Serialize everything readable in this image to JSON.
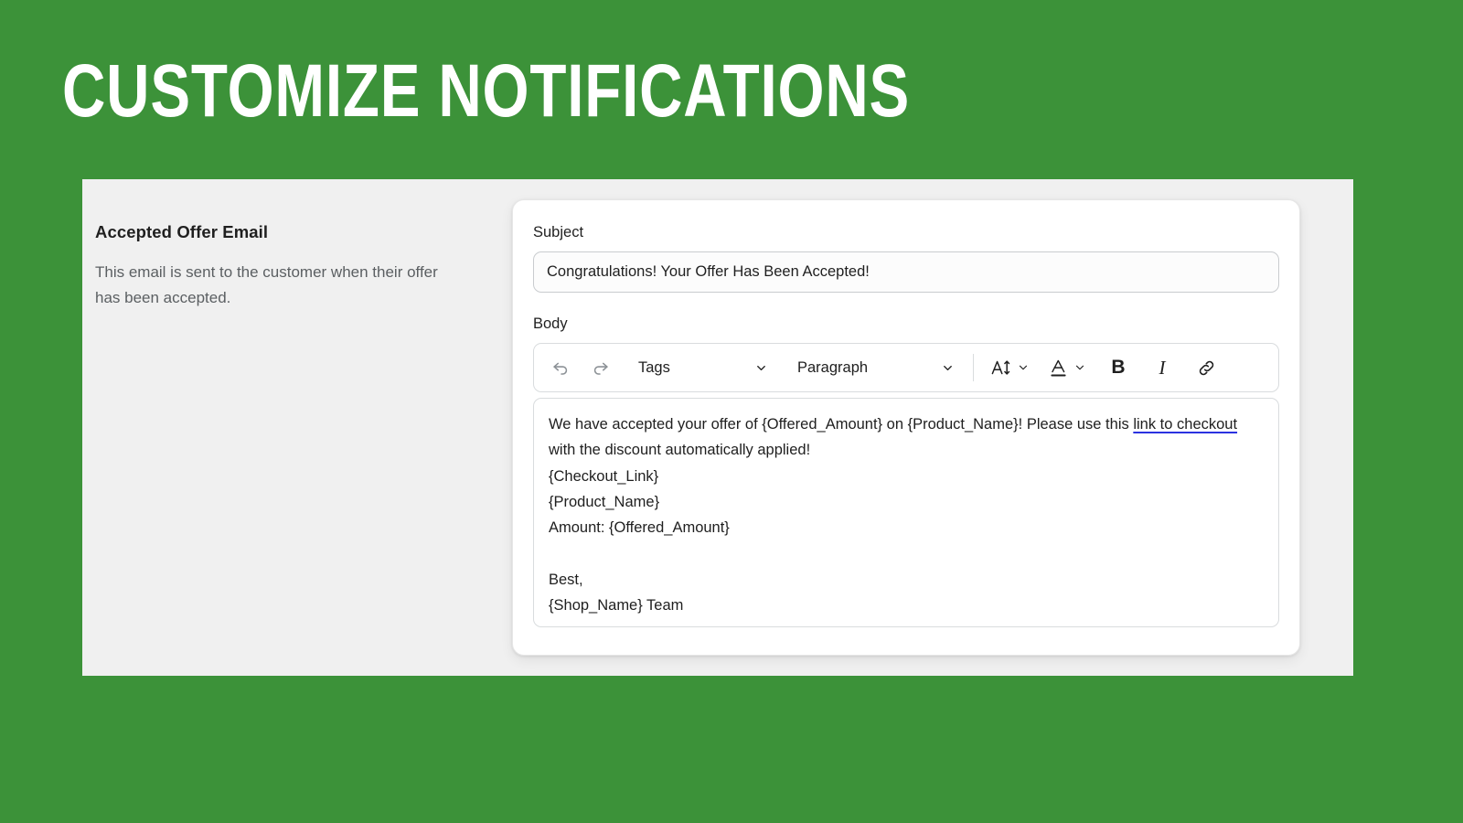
{
  "page": {
    "title": "Customize Notifications",
    "background_color": "#3c9239",
    "panel_color": "#f0f0f0",
    "card_color": "#ffffff"
  },
  "left": {
    "heading": "Accepted Offer Email",
    "description": "This email is sent to the customer when their offer has been accepted."
  },
  "form": {
    "subject": {
      "label": "Subject",
      "value": "Congratulations! Your Offer Has Been Accepted!"
    },
    "body": {
      "label": "Body"
    }
  },
  "toolbar": {
    "undo": "undo-icon",
    "redo": "redo-icon",
    "tags_select": {
      "label": "Tags",
      "chevron": "chevron-down-icon"
    },
    "paragraph_select": {
      "label": "Paragraph",
      "chevron": "chevron-down-icon"
    },
    "font_size": {
      "icon": "font-size-icon",
      "chevron": "chevron-down-icon"
    },
    "text_color": {
      "icon": "text-color-icon",
      "chevron": "chevron-down-icon"
    },
    "bold": "B",
    "italic": "I",
    "link": "link-icon"
  },
  "body_content": {
    "line1_before_link": "We have accepted your offer of {Offered_Amount} on {Product_Name}! Please use this ",
    "link_text": "link to checkout",
    "line1_after_link": " with the discount automatically applied!",
    "line2": "{Checkout_Link}",
    "line3": "{Product_Name}",
    "line4": "Amount: {Offered_Amount}",
    "line5": "",
    "line6": "Best,",
    "line7": "{Shop_Name} Team",
    "link_underline_color": "#2b32e0"
  }
}
